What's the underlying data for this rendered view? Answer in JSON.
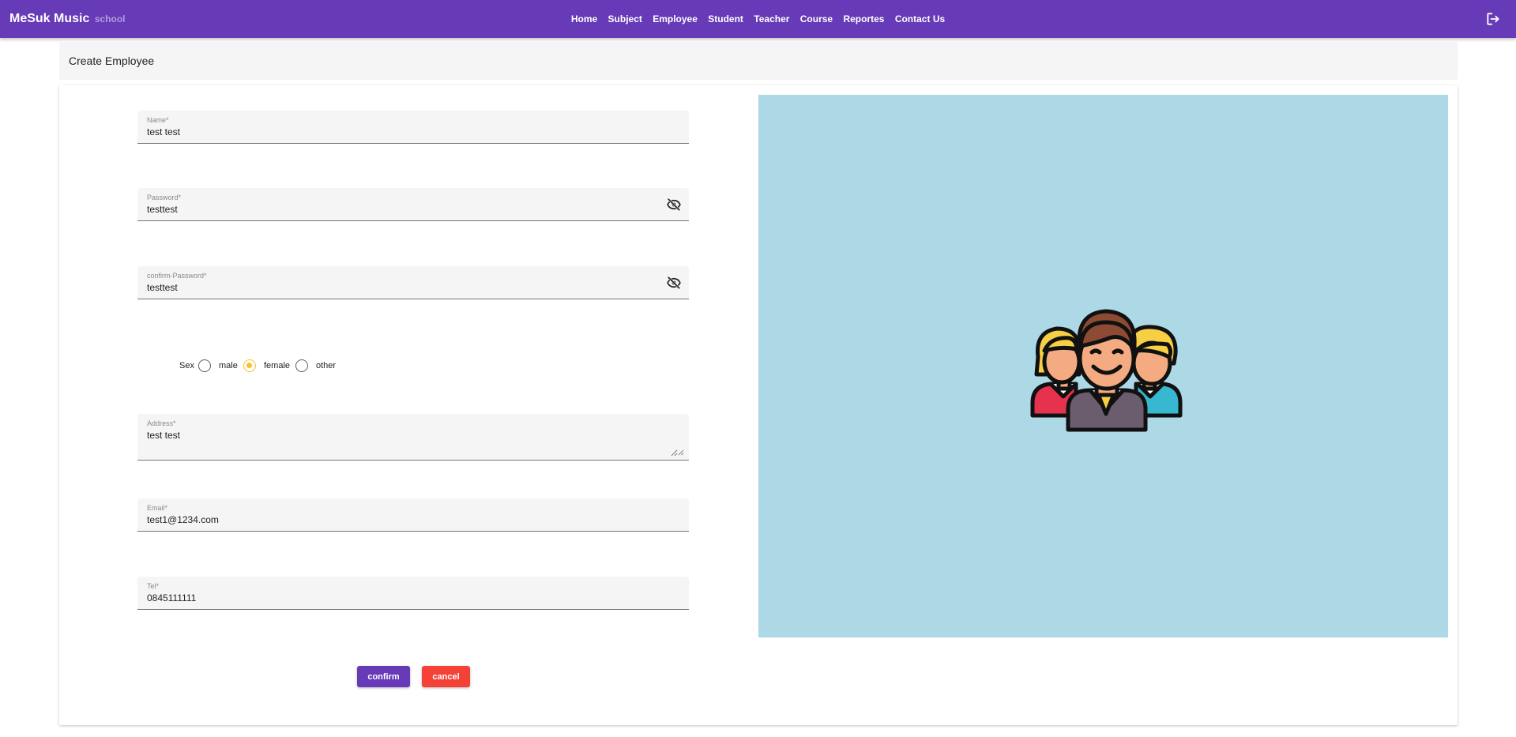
{
  "app": {
    "brand": "MeSuk Music",
    "brand_sub": "school"
  },
  "nav": {
    "items": [
      "Home",
      "Subject",
      "Employee",
      "Student",
      "Teacher",
      "Course",
      "Reportes",
      "Contact Us"
    ]
  },
  "page": {
    "title": "Create Employee"
  },
  "form": {
    "name": {
      "label": "Name*",
      "value": "test test"
    },
    "password": {
      "label": "Password*",
      "value": "testtest"
    },
    "confirm_password": {
      "label": "confirm-Password*",
      "value": "testtest"
    },
    "sex": {
      "label": "Sex",
      "options": [
        "male",
        "female",
        "other"
      ],
      "selected": "female"
    },
    "address": {
      "label": "Address*",
      "value": "test test"
    },
    "email": {
      "label": "Email*",
      "value": "test1@1234.com"
    },
    "tel": {
      "label": "Tel*",
      "value": "0845111111"
    }
  },
  "buttons": {
    "confirm": "confirm",
    "cancel": "cancel"
  },
  "icons": {
    "logout": "logout-icon",
    "password_visibility": "eye-off-icon",
    "illustration": "employees-group-icon"
  },
  "colors": {
    "primary": "#673ab7",
    "danger": "#f44336",
    "accent": "#fbc02d",
    "panel": "#add8e6"
  }
}
